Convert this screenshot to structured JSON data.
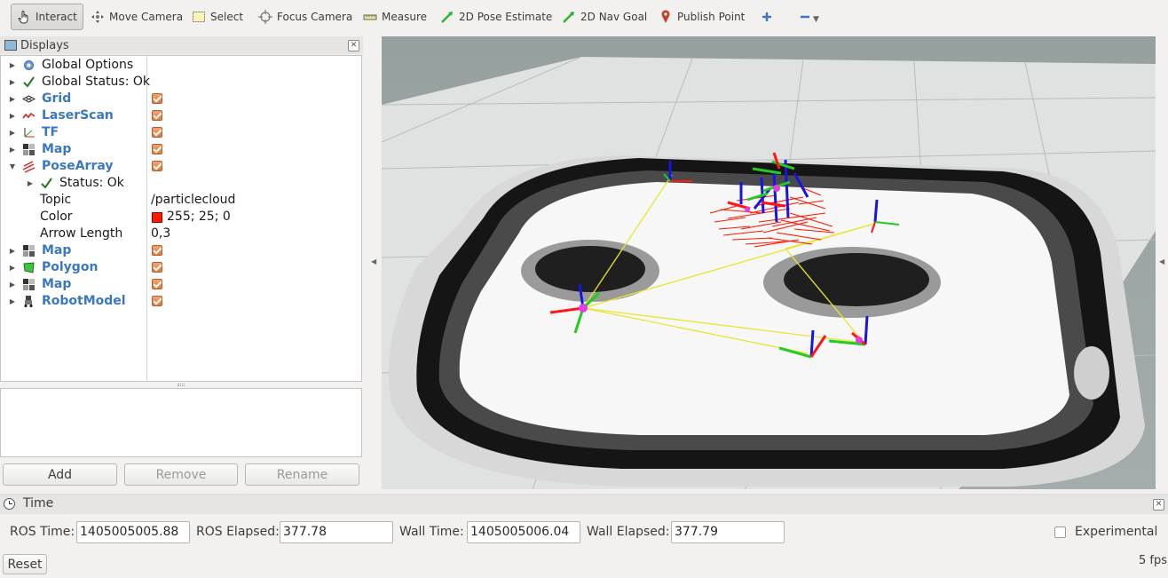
{
  "toolbar": {
    "items": [
      {
        "label": "Interact",
        "icon": "hand-pointer-icon",
        "active": true
      },
      {
        "label": "Move Camera",
        "icon": "move-camera-icon"
      },
      {
        "label": "Select",
        "icon": "select-box-icon"
      },
      {
        "label": "Focus Camera",
        "icon": "focus-crosshair-icon"
      },
      {
        "label": "Measure",
        "icon": "ruler-icon"
      },
      {
        "label": "2D Pose Estimate",
        "icon": "green-arrow-icon"
      },
      {
        "label": "2D Nav Goal",
        "icon": "green-arrow-icon"
      },
      {
        "label": "Publish Point",
        "icon": "map-pin-icon"
      }
    ],
    "add_tool_icon": "plus-icon",
    "remove_tool_icon": "minus-icon"
  },
  "displays": {
    "title": "Displays",
    "rows": [
      {
        "name": "Global Options",
        "icon": "gear-icon",
        "blue": false
      },
      {
        "name": "Global Status: Ok",
        "icon": "checkmark-icon",
        "blue": false
      },
      {
        "name": "Grid",
        "icon": "grid-icon",
        "blue": true,
        "checked": true
      },
      {
        "name": "LaserScan",
        "icon": "laserscan-icon",
        "blue": true,
        "checked": true
      },
      {
        "name": "TF",
        "icon": "tf-axes-icon",
        "blue": true,
        "checked": true
      },
      {
        "name": "Map",
        "icon": "map-icon",
        "blue": true,
        "checked": true
      },
      {
        "name": "PoseArray",
        "icon": "posearray-icon",
        "blue": true,
        "checked": true,
        "expanded": true
      },
      {
        "name": "Status: Ok",
        "icon": "checkmark-icon",
        "blue": false,
        "child": true
      },
      {
        "name": "Topic",
        "value": "/particlecloud",
        "property": true
      },
      {
        "name": "Color",
        "value": "255; 25; 0",
        "property": true,
        "swatch": "#ff1900"
      },
      {
        "name": "Arrow Length",
        "value": "0,3",
        "property": true
      },
      {
        "name": "Map",
        "icon": "map-icon",
        "blue": true,
        "checked": true
      },
      {
        "name": "Polygon",
        "icon": "polygon-icon",
        "blue": true,
        "checked": true
      },
      {
        "name": "Map",
        "icon": "map-icon",
        "blue": true,
        "checked": true
      },
      {
        "name": "RobotModel",
        "icon": "robot-icon",
        "blue": true,
        "checked": true
      }
    ],
    "buttons": {
      "add": "Add",
      "remove": "Remove",
      "rename": "Rename"
    }
  },
  "time": {
    "title": "Time",
    "ros_time_label": "ROS Time:",
    "ros_time": "1405005005.88",
    "ros_elapsed_label": "ROS Elapsed:",
    "ros_elapsed": "377.78",
    "wall_time_label": "Wall Time:",
    "wall_time": "1405005006.04",
    "wall_elapsed_label": "Wall Elapsed:",
    "wall_elapsed": "377.79",
    "experimental_label": "Experimental"
  },
  "status": {
    "reset": "Reset",
    "fps": "5 fps"
  },
  "colors": {
    "accent_blue": "#3a78c3",
    "checkbox_orange": "#e6793a",
    "particle_red": "#ff1900"
  }
}
